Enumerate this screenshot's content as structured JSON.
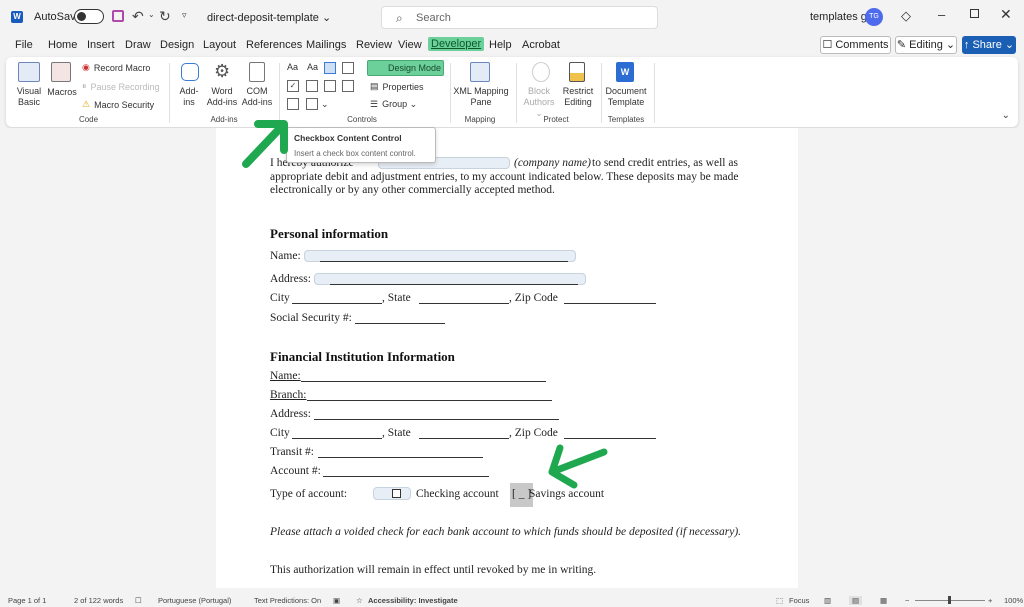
{
  "titlebar": {
    "autosave_label": "AutoSave",
    "doc_title": "direct-deposit-template ⌄",
    "search_placeholder": "Search",
    "username": "templates go",
    "avatar_initials": "TG"
  },
  "tabs": [
    "File",
    "Home",
    "Insert",
    "Draw",
    "Design",
    "Layout",
    "References",
    "Mailings",
    "Review",
    "View",
    "Developer",
    "Help",
    "Acrobat"
  ],
  "active_tab": "Developer",
  "actions": {
    "comments": "☐ Comments",
    "editing": "✎ Editing ⌄",
    "share": "↑ Share ⌄"
  },
  "ribbon": {
    "code": {
      "visual_basic": "Visual Basic",
      "macros": "Macros",
      "record_macro": "Record Macro",
      "pause_recording": "Pause Recording",
      "macro_security": "Macro Security",
      "label": "Code"
    },
    "addins": {
      "addins": "Add-ins",
      "word_addins": "Word Add-ins",
      "com_addins": "COM Add-ins",
      "label": "Add-ins"
    },
    "controls": {
      "design_mode": "Design Mode",
      "properties": "Properties",
      "group": "Group ⌄",
      "label": "Controls"
    },
    "mapping": {
      "xml_mapping_pane": "XML Mapping Pane",
      "label": "Mapping"
    },
    "protect": {
      "block_authors": "Block Authors ⌄",
      "restrict_editing": "Restrict Editing",
      "label": "Protect"
    },
    "templates": {
      "document_template": "Document Template",
      "label": "Templates"
    }
  },
  "tooltip": {
    "title": "Checkbox Content Control",
    "description": "Insert a check box content control."
  },
  "document": {
    "intro_start": "I hereby authorize",
    "intro_company": "(company name)",
    "intro_rest": " to send credit entries, as well as",
    "intro_line2": "appropriate debit and adjustment entries, to my account indicated below. These deposits may be made",
    "intro_line3": "electronically or by any other commercially accepted method.",
    "personal_heading": "Personal information",
    "name_label": "Name:",
    "address_label": "Address:",
    "city_label": "City",
    "state_label": ", State",
    "zip_label": ",  Zip Code",
    "ssn_label": "Social Security #:",
    "financial_heading": "Financial Institution Information",
    "fin_name_label": "Name:",
    "branch_label": "Branch:",
    "fin_address_label": "Address:",
    "transit_label": "Transit #:",
    "account_label": "Account #:",
    "type_label": "Type of account:",
    "checking_label": "Checking account",
    "savings_box": "[ _ ]",
    "savings_label": "Savings account",
    "attach_note": "Please attach a voided check for each bank account to which funds should be deposited (if necessary).",
    "authorization_note": "This authorization will remain in effect until revoked by me in writing."
  },
  "statusbar": {
    "page": "Page 1 of 1",
    "words": "2 of 122 words",
    "language": "Portuguese (Portugal)",
    "predictions": "Text Predictions: On",
    "accessibility": "Accessibility: Investigate",
    "focus": "Focus",
    "zoom": "100%"
  },
  "colors": {
    "accent": "#1a5fb4",
    "developer_highlight": "#6bd09a",
    "annotation_arrow": "#1fa84f"
  }
}
